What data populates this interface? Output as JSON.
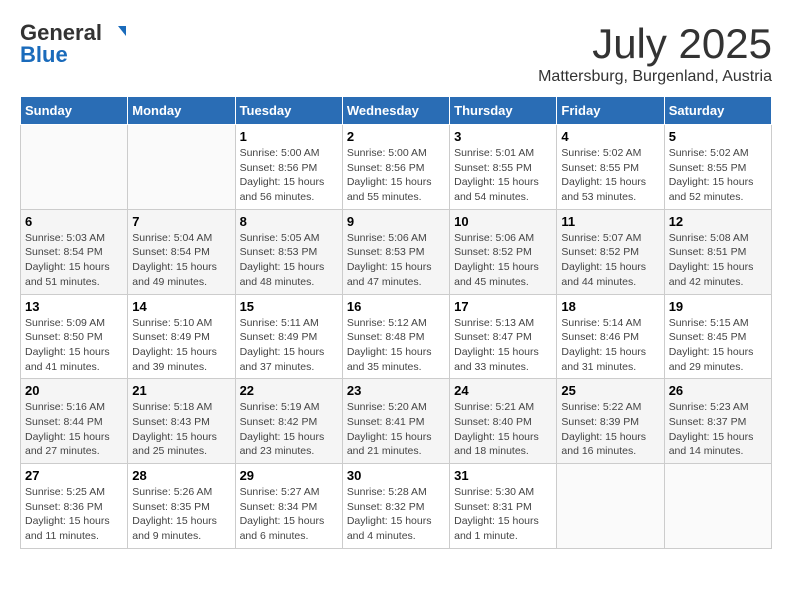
{
  "header": {
    "logo_general": "General",
    "logo_blue": "Blue",
    "month": "July 2025",
    "location": "Mattersburg, Burgenland, Austria"
  },
  "weekdays": [
    "Sunday",
    "Monday",
    "Tuesday",
    "Wednesday",
    "Thursday",
    "Friday",
    "Saturday"
  ],
  "weeks": [
    [
      {
        "day": "",
        "info": ""
      },
      {
        "day": "",
        "info": ""
      },
      {
        "day": "1",
        "info": "Sunrise: 5:00 AM\nSunset: 8:56 PM\nDaylight: 15 hours\nand 56 minutes."
      },
      {
        "day": "2",
        "info": "Sunrise: 5:00 AM\nSunset: 8:56 PM\nDaylight: 15 hours\nand 55 minutes."
      },
      {
        "day": "3",
        "info": "Sunrise: 5:01 AM\nSunset: 8:55 PM\nDaylight: 15 hours\nand 54 minutes."
      },
      {
        "day": "4",
        "info": "Sunrise: 5:02 AM\nSunset: 8:55 PM\nDaylight: 15 hours\nand 53 minutes."
      },
      {
        "day": "5",
        "info": "Sunrise: 5:02 AM\nSunset: 8:55 PM\nDaylight: 15 hours\nand 52 minutes."
      }
    ],
    [
      {
        "day": "6",
        "info": "Sunrise: 5:03 AM\nSunset: 8:54 PM\nDaylight: 15 hours\nand 51 minutes."
      },
      {
        "day": "7",
        "info": "Sunrise: 5:04 AM\nSunset: 8:54 PM\nDaylight: 15 hours\nand 49 minutes."
      },
      {
        "day": "8",
        "info": "Sunrise: 5:05 AM\nSunset: 8:53 PM\nDaylight: 15 hours\nand 48 minutes."
      },
      {
        "day": "9",
        "info": "Sunrise: 5:06 AM\nSunset: 8:53 PM\nDaylight: 15 hours\nand 47 minutes."
      },
      {
        "day": "10",
        "info": "Sunrise: 5:06 AM\nSunset: 8:52 PM\nDaylight: 15 hours\nand 45 minutes."
      },
      {
        "day": "11",
        "info": "Sunrise: 5:07 AM\nSunset: 8:52 PM\nDaylight: 15 hours\nand 44 minutes."
      },
      {
        "day": "12",
        "info": "Sunrise: 5:08 AM\nSunset: 8:51 PM\nDaylight: 15 hours\nand 42 minutes."
      }
    ],
    [
      {
        "day": "13",
        "info": "Sunrise: 5:09 AM\nSunset: 8:50 PM\nDaylight: 15 hours\nand 41 minutes."
      },
      {
        "day": "14",
        "info": "Sunrise: 5:10 AM\nSunset: 8:49 PM\nDaylight: 15 hours\nand 39 minutes."
      },
      {
        "day": "15",
        "info": "Sunrise: 5:11 AM\nSunset: 8:49 PM\nDaylight: 15 hours\nand 37 minutes."
      },
      {
        "day": "16",
        "info": "Sunrise: 5:12 AM\nSunset: 8:48 PM\nDaylight: 15 hours\nand 35 minutes."
      },
      {
        "day": "17",
        "info": "Sunrise: 5:13 AM\nSunset: 8:47 PM\nDaylight: 15 hours\nand 33 minutes."
      },
      {
        "day": "18",
        "info": "Sunrise: 5:14 AM\nSunset: 8:46 PM\nDaylight: 15 hours\nand 31 minutes."
      },
      {
        "day": "19",
        "info": "Sunrise: 5:15 AM\nSunset: 8:45 PM\nDaylight: 15 hours\nand 29 minutes."
      }
    ],
    [
      {
        "day": "20",
        "info": "Sunrise: 5:16 AM\nSunset: 8:44 PM\nDaylight: 15 hours\nand 27 minutes."
      },
      {
        "day": "21",
        "info": "Sunrise: 5:18 AM\nSunset: 8:43 PM\nDaylight: 15 hours\nand 25 minutes."
      },
      {
        "day": "22",
        "info": "Sunrise: 5:19 AM\nSunset: 8:42 PM\nDaylight: 15 hours\nand 23 minutes."
      },
      {
        "day": "23",
        "info": "Sunrise: 5:20 AM\nSunset: 8:41 PM\nDaylight: 15 hours\nand 21 minutes."
      },
      {
        "day": "24",
        "info": "Sunrise: 5:21 AM\nSunset: 8:40 PM\nDaylight: 15 hours\nand 18 minutes."
      },
      {
        "day": "25",
        "info": "Sunrise: 5:22 AM\nSunset: 8:39 PM\nDaylight: 15 hours\nand 16 minutes."
      },
      {
        "day": "26",
        "info": "Sunrise: 5:23 AM\nSunset: 8:37 PM\nDaylight: 15 hours\nand 14 minutes."
      }
    ],
    [
      {
        "day": "27",
        "info": "Sunrise: 5:25 AM\nSunset: 8:36 PM\nDaylight: 15 hours\nand 11 minutes."
      },
      {
        "day": "28",
        "info": "Sunrise: 5:26 AM\nSunset: 8:35 PM\nDaylight: 15 hours\nand 9 minutes."
      },
      {
        "day": "29",
        "info": "Sunrise: 5:27 AM\nSunset: 8:34 PM\nDaylight: 15 hours\nand 6 minutes."
      },
      {
        "day": "30",
        "info": "Sunrise: 5:28 AM\nSunset: 8:32 PM\nDaylight: 15 hours\nand 4 minutes."
      },
      {
        "day": "31",
        "info": "Sunrise: 5:30 AM\nSunset: 8:31 PM\nDaylight: 15 hours\nand 1 minute."
      },
      {
        "day": "",
        "info": ""
      },
      {
        "day": "",
        "info": ""
      }
    ]
  ]
}
